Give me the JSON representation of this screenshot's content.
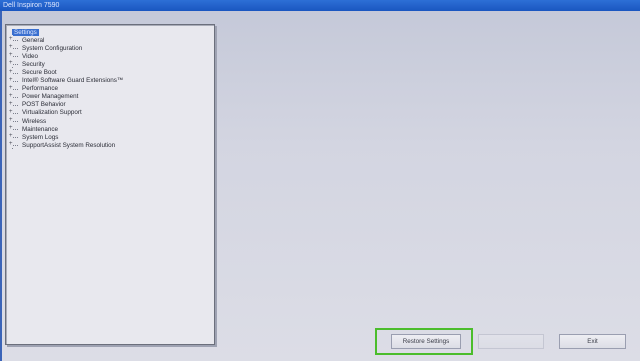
{
  "window": {
    "title": "Dell Inspiron 7590"
  },
  "tree": {
    "root_label": "Settings",
    "items": [
      {
        "label": "General"
      },
      {
        "label": "System Configuration"
      },
      {
        "label": "Video"
      },
      {
        "label": "Security"
      },
      {
        "label": "Secure Boot"
      },
      {
        "label": "Intel® Software Guard Extensions™"
      },
      {
        "label": "Performance"
      },
      {
        "label": "Power Management"
      },
      {
        "label": "POST Behavior"
      },
      {
        "label": "Virtualization Support"
      },
      {
        "label": "Wireless"
      },
      {
        "label": "Maintenance"
      },
      {
        "label": "System Logs"
      },
      {
        "label": "SupportAssist System Resolution"
      }
    ]
  },
  "buttons": {
    "restore_label": "Restore Settings",
    "disabled_label": "",
    "exit_label": "Exit"
  },
  "colors": {
    "highlight": "#4bbd2c",
    "selection": "#3a6fcf",
    "titlebar": "#1a56c0"
  },
  "icons": {
    "expander": "plus-expander-icon"
  }
}
